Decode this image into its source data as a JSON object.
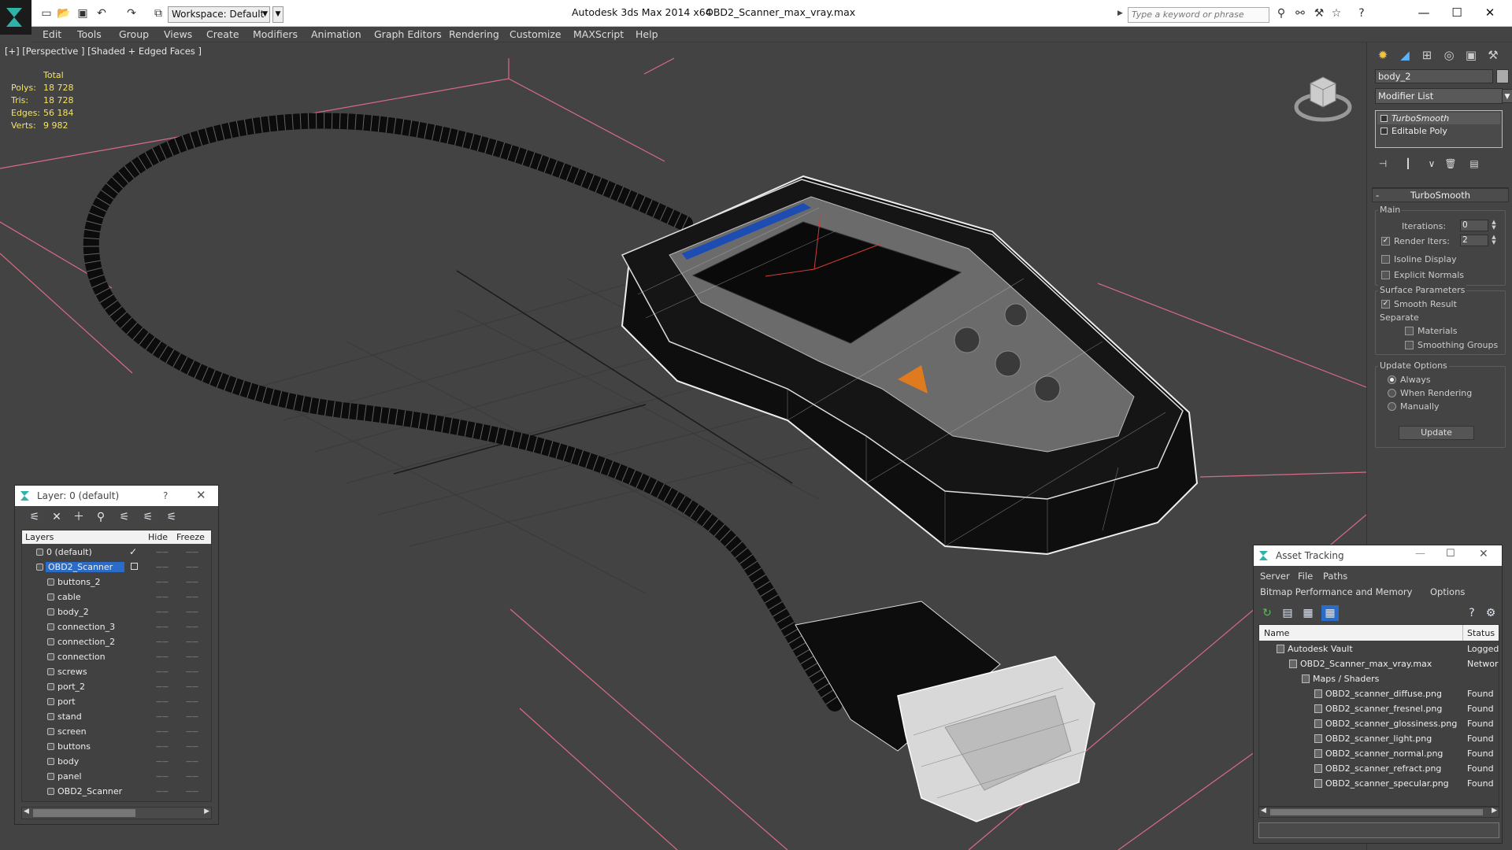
{
  "titlebar": {
    "workspace": "Workspace: Default",
    "app_title": "Autodesk 3ds Max  2014 x64",
    "file_title": "OBD2_Scanner_max_vray.max",
    "search_placeholder": "Type a keyword or phrase"
  },
  "menu": [
    "Edit",
    "Tools",
    "Group",
    "Views",
    "Create",
    "Modifiers",
    "Animation",
    "Graph Editors",
    "Rendering",
    "Customize",
    "MAXScript",
    "Help"
  ],
  "viewport": {
    "label": "[+] [Perspective ] [Shaded + Edged Faces ]",
    "stats": {
      "header": "Total",
      "rows": [
        {
          "k": "Polys:",
          "v": "18 728"
        },
        {
          "k": "Tris:",
          "v": "18 728"
        },
        {
          "k": "Edges:",
          "v": "56 184"
        },
        {
          "k": "Verts:",
          "v": "9 982"
        }
      ]
    }
  },
  "command_panel": {
    "object_name": "body_2",
    "modifier_list": "Modifier List",
    "stack": [
      "TurboSmooth",
      "Editable Poly"
    ],
    "rollout_title": "TurboSmooth",
    "main_label": "Main",
    "iterations_label": "Iterations:",
    "iterations_value": "0",
    "render_iters_label": "Render Iters:",
    "render_iters_value": "2",
    "render_iters_checked": true,
    "isoline_label": "Isoline Display",
    "explicit_label": "Explicit Normals",
    "surface_label": "Surface Parameters",
    "smooth_label": "Smooth Result",
    "separate_label": "Separate",
    "materials_label": "Materials",
    "smoothing_groups_label": "Smoothing Groups",
    "update_options_label": "Update Options",
    "radio_always": "Always",
    "radio_rendering": "When Rendering",
    "radio_manually": "Manually",
    "update_button": "Update"
  },
  "layer_dialog": {
    "title": "Layer: 0 (default)",
    "help": "?",
    "columns": [
      "Layers",
      "Hide",
      "Freeze"
    ],
    "rows": [
      {
        "name": "0 (default)",
        "level": 0,
        "current": true
      },
      {
        "name": "OBD2_Scanner",
        "level": 0,
        "selected": true
      },
      {
        "name": "buttons_2",
        "level": 1
      },
      {
        "name": "cable",
        "level": 1
      },
      {
        "name": "body_2",
        "level": 1
      },
      {
        "name": "connection_3",
        "level": 1
      },
      {
        "name": "connection_2",
        "level": 1
      },
      {
        "name": "connection",
        "level": 1
      },
      {
        "name": "screws",
        "level": 1
      },
      {
        "name": "port_2",
        "level": 1
      },
      {
        "name": "port",
        "level": 1
      },
      {
        "name": "stand",
        "level": 1
      },
      {
        "name": "screen",
        "level": 1
      },
      {
        "name": "buttons",
        "level": 1
      },
      {
        "name": "body",
        "level": 1
      },
      {
        "name": "panel",
        "level": 1
      },
      {
        "name": "OBD2_Scanner",
        "level": 1
      }
    ]
  },
  "asset_dialog": {
    "title": "Asset Tracking",
    "menu_row1": [
      "Server",
      "File",
      "Paths"
    ],
    "menu_row2": [
      "Bitmap Performance and Memory",
      "Options"
    ],
    "columns": [
      "Name",
      "Status"
    ],
    "rows": [
      {
        "name": "Autodesk Vault",
        "status": "Logged O",
        "level": 0
      },
      {
        "name": "OBD2_Scanner_max_vray.max",
        "status": "Network",
        "level": 1
      },
      {
        "name": "Maps / Shaders",
        "status": "",
        "level": 2
      },
      {
        "name": "OBD2_scanner_diffuse.png",
        "status": "Found",
        "level": 3
      },
      {
        "name": "OBD2_scanner_fresnel.png",
        "status": "Found",
        "level": 3
      },
      {
        "name": "OBD2_scanner_glossiness.png",
        "status": "Found",
        "level": 3
      },
      {
        "name": "OBD2_scanner_light.png",
        "status": "Found",
        "level": 3
      },
      {
        "name": "OBD2_scanner_normal.png",
        "status": "Found",
        "level": 3
      },
      {
        "name": "OBD2_scanner_refract.png",
        "status": "Found",
        "level": 3
      },
      {
        "name": "OBD2_scanner_specular.png",
        "status": "Found",
        "level": 3
      }
    ]
  },
  "colors": {
    "stats_yellow": "#f2e26a",
    "selection_blue": "#2a6cc7",
    "grid_pink": "#d86b86",
    "viewport_bg": "#434343"
  }
}
